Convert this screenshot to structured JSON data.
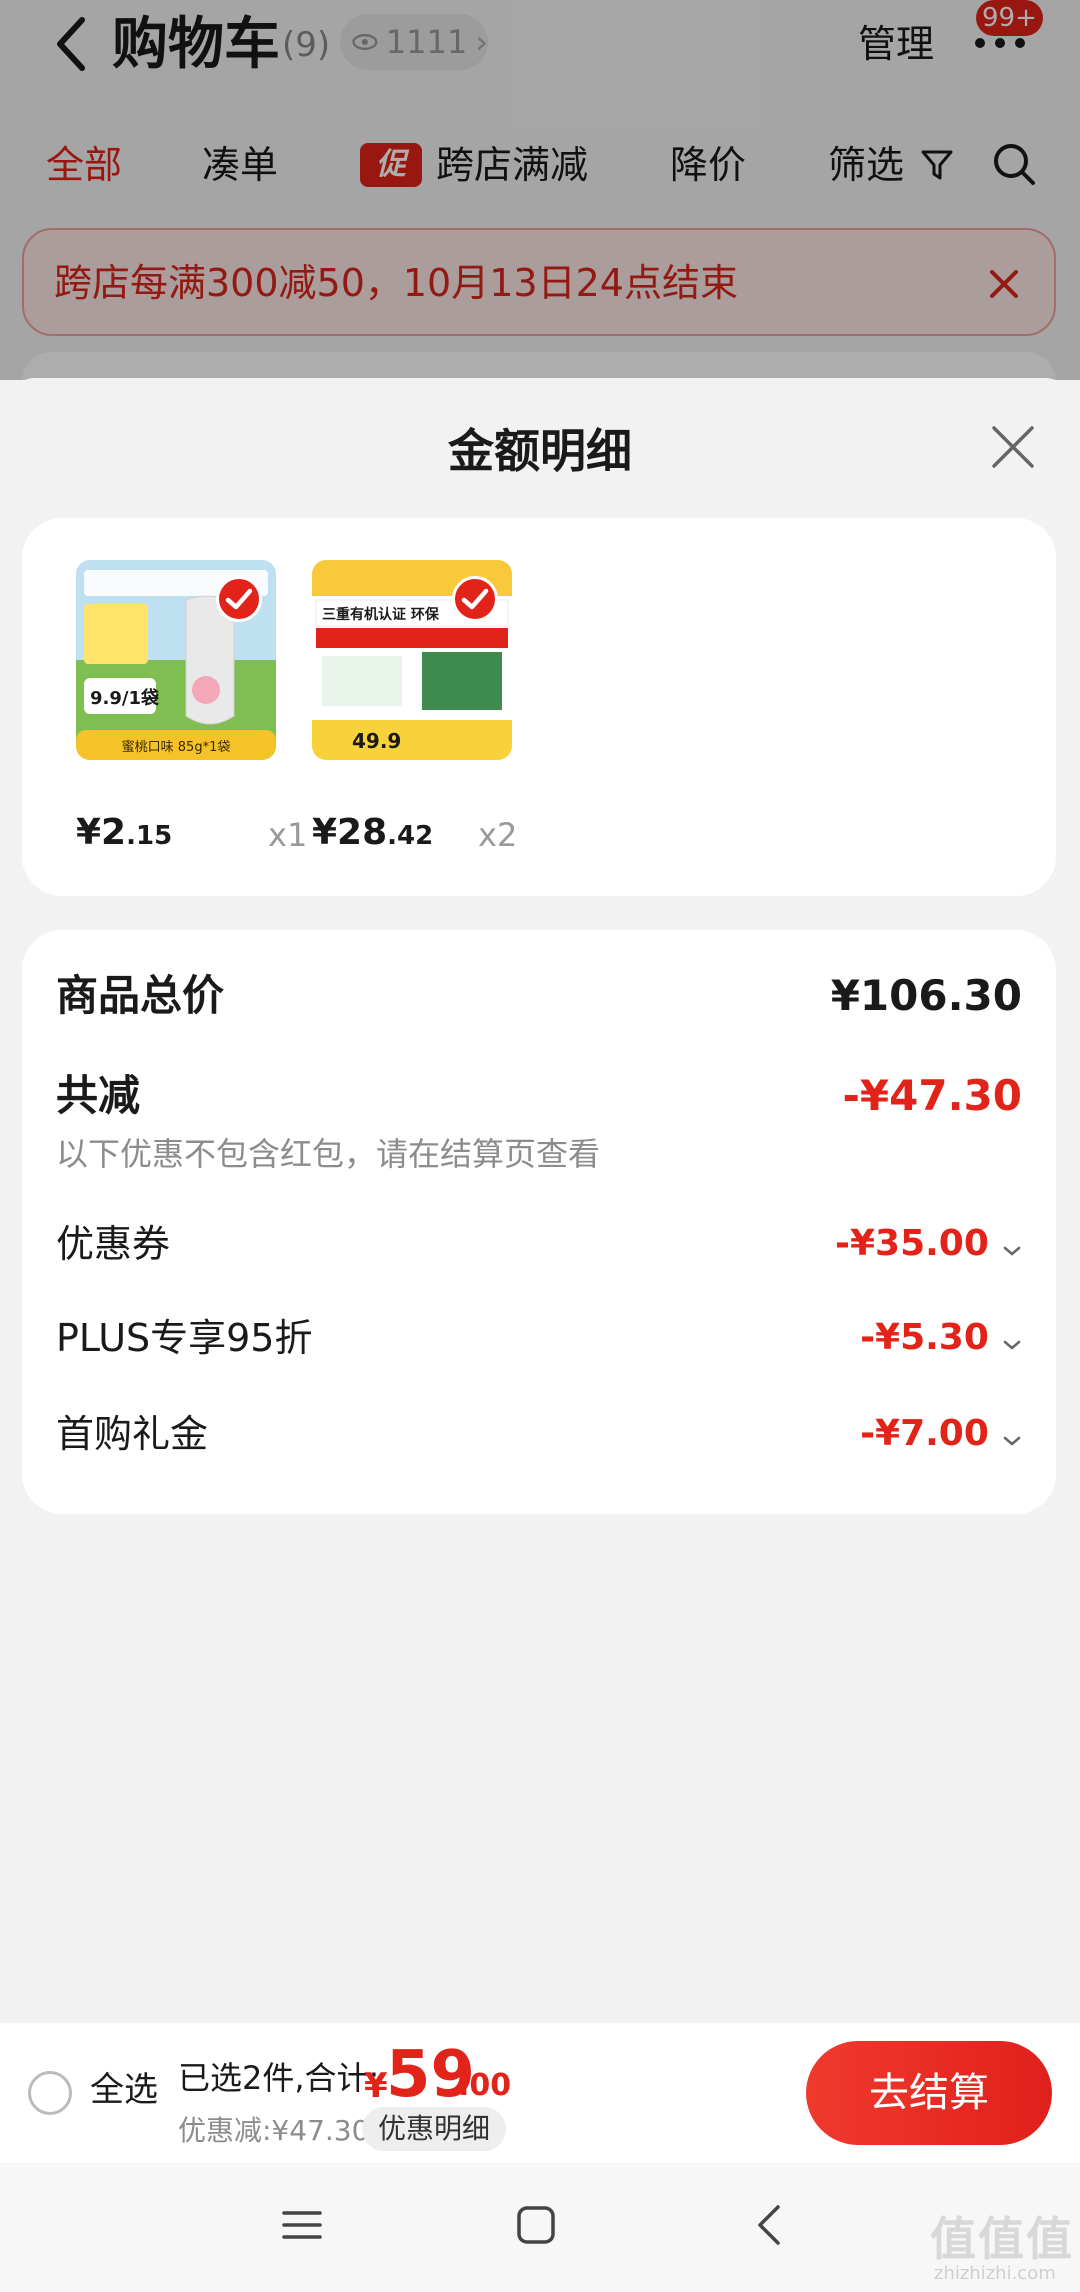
{
  "header": {
    "title": "购物车",
    "count": "(9)",
    "watch_count": "1111",
    "manage_label": "管理",
    "badge": "99+"
  },
  "tabs": [
    "全部",
    "凑单",
    "跨店满减",
    "降价",
    "筛选"
  ],
  "promo_tag": "促",
  "notice": {
    "text": "跨店每满300减50，10月13日24点结束"
  },
  "sheet": {
    "title": "金额明细",
    "items": [
      {
        "price_int": "¥2",
        "price_dec": ".15",
        "qty": "x1",
        "image_text": "9.9/1袋",
        "image_caption": "蜜桃口味 85g*1袋"
      },
      {
        "price_int": "¥28",
        "price_dec": ".42",
        "qty": "x2",
        "image_text": "三重有机认证 环保",
        "image_caption": "49.9"
      }
    ],
    "total_label": "商品总价",
    "total_value": "¥106.30",
    "reduce_label": "共减",
    "reduce_value": "-¥47.30",
    "reduce_note": "以下优惠不包含红包，请在结算页查看",
    "discounts": [
      {
        "label": "优惠券",
        "value": "-¥35.00"
      },
      {
        "label": "PLUS专享95折",
        "value": "-¥5.30"
      },
      {
        "label": "首购礼金",
        "value": "-¥7.00"
      }
    ]
  },
  "bottom": {
    "select_all": "全选",
    "selected_text": "已选2件,合计:",
    "currency": "¥",
    "total_int": "59",
    "total_dec": ".00",
    "discount_text": "优惠减:¥47.30",
    "detail_label": "优惠明细",
    "checkout_label": "去结算"
  },
  "watermark": {
    "text": "值值值",
    "sub": "zhizhizhi.com"
  },
  "colors": {
    "accent": "#e2231a"
  },
  "icons": [
    "back-arrow-icon",
    "eye-icon",
    "more-dots-icon",
    "filter-icon",
    "search-icon",
    "close-icon",
    "checkmark-icon",
    "chevron-down-icon",
    "menu-icon",
    "home-square-icon",
    "back-nav-icon"
  ]
}
